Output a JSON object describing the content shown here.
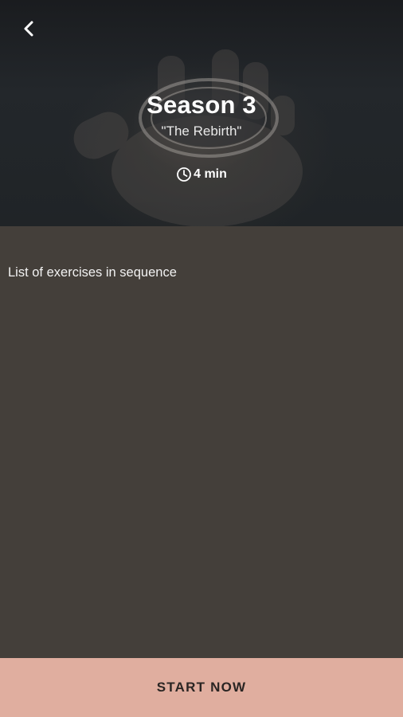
{
  "header": {
    "back_icon": "chevron-left-icon",
    "title": "Season 3",
    "subtitle": "\"The Rebirth\"",
    "duration": {
      "icon": "clock-icon",
      "label": "4 min"
    }
  },
  "content": {
    "exercises_label": "List of exercises in sequence"
  },
  "footer": {
    "cta_label": "START NOW"
  },
  "colors": {
    "cta_background": "#e0ae9f",
    "content_background": "#443f3a",
    "header_background": "#202427"
  }
}
